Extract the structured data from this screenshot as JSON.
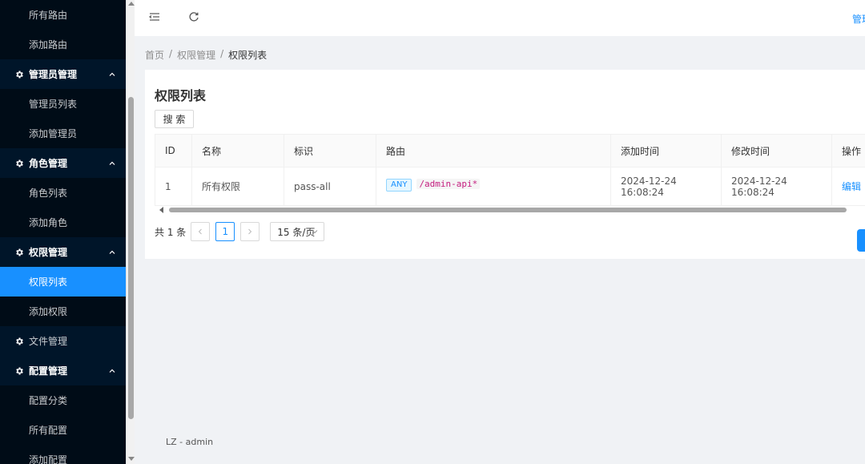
{
  "sidebar": {
    "items": [
      {
        "type": "sub",
        "label": "所有路由"
      },
      {
        "type": "sub",
        "label": "添加路由"
      },
      {
        "type": "group",
        "label": "管理员管理",
        "expanded": true
      },
      {
        "type": "sub",
        "label": "管理员列表"
      },
      {
        "type": "sub",
        "label": "添加管理员"
      },
      {
        "type": "group",
        "label": "角色管理",
        "expanded": true
      },
      {
        "type": "sub",
        "label": "角色列表"
      },
      {
        "type": "sub",
        "label": "添加角色"
      },
      {
        "type": "group",
        "label": "权限管理",
        "expanded": true
      },
      {
        "type": "sub",
        "label": "权限列表",
        "active": true
      },
      {
        "type": "sub",
        "label": "添加权限"
      },
      {
        "type": "group",
        "label": "文件管理",
        "expanded": false
      },
      {
        "type": "group",
        "label": "配置管理",
        "expanded": true
      },
      {
        "type": "sub",
        "label": "配置分类"
      },
      {
        "type": "sub",
        "label": "所有配置"
      },
      {
        "type": "sub",
        "label": "添加配置"
      }
    ]
  },
  "header": {
    "menu_toggle_icon": "menu-fold-icon",
    "reload_icon": "reload-icon",
    "user_label": "管理"
  },
  "breadcrumb": {
    "items": [
      "首页",
      "权限管理",
      "权限列表"
    ],
    "separator": "/"
  },
  "card": {
    "title": "权限列表",
    "search_label": "搜 索"
  },
  "table": {
    "columns": [
      "ID",
      "名称",
      "标识",
      "路由",
      "添加时间",
      "修改时间",
      "操作"
    ],
    "rows": [
      {
        "id": "1",
        "name": "所有权限",
        "slug": "pass-all",
        "route_method": "ANY",
        "route_path": "/admin-api*",
        "created_at": "2024-12-24 16:08:24",
        "updated_at": "2024-12-24 16:08:24",
        "action": "编辑"
      }
    ]
  },
  "pagination": {
    "total_text": "共 1 条",
    "current_page": "1",
    "page_size": "15 条/页"
  },
  "footer": {
    "text": "LZ - admin"
  },
  "colors": {
    "sidebar_bg": "#001529",
    "submenu_bg": "#000c17",
    "active": "#1890ff",
    "route_path": "#c41d7f"
  }
}
